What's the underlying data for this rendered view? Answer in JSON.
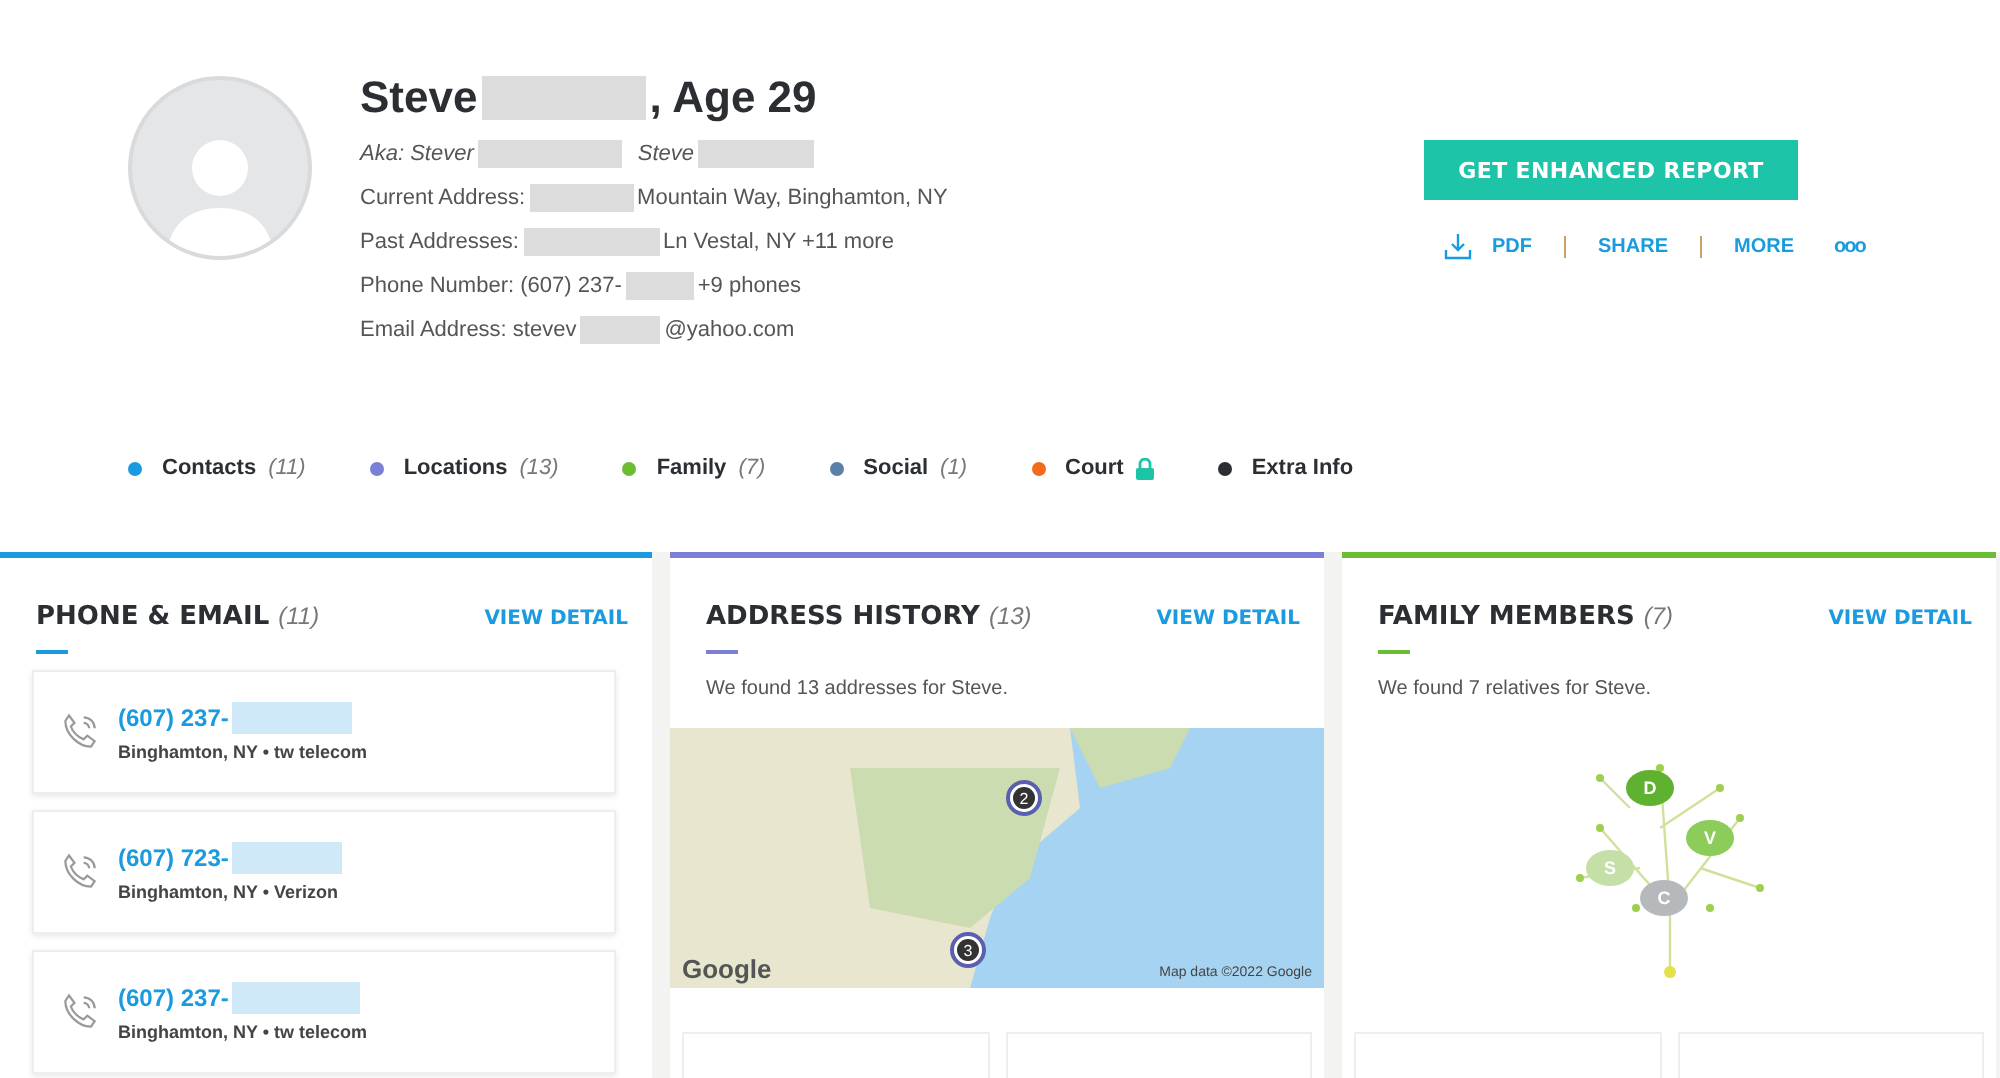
{
  "profile": {
    "name_first": "Steve",
    "name_rest": ", Age 29",
    "aka_label": "Aka:",
    "aka": [
      "Stever",
      "Steve"
    ],
    "details": [
      {
        "label": "Current Address:",
        "value": "Mountain Way, Binghamton, NY"
      },
      {
        "label": "Past Addresses:",
        "value": "Ln Vestal, NY +11 more"
      },
      {
        "label": "Phone Number: (607) 237-",
        "value": "+9 phones"
      },
      {
        "label": "Email Address: stevev",
        "value": "@yahoo.com"
      }
    ]
  },
  "actions": {
    "primary": "GET ENHANCED REPORT",
    "links": [
      "PDF",
      "SHARE",
      "MORE"
    ],
    "more_icon": "ooo"
  },
  "sections_nav": [
    {
      "label": "Contacts",
      "count": "(11)",
      "color": "#1a9be0",
      "locked": false
    },
    {
      "label": "Locations",
      "count": "(13)",
      "color": "#7b7fd6",
      "locked": false
    },
    {
      "label": "Family",
      "count": "(7)",
      "color": "#6cbd36",
      "locked": false
    },
    {
      "label": "Social",
      "count": "(1)",
      "color": "#5a7fa8",
      "locked": false
    },
    {
      "label": "Court",
      "color": "#f26b1d",
      "locked": true
    },
    {
      "label": "Extra Info",
      "color": "#2b2f33",
      "locked": false
    }
  ],
  "cards": [
    {
      "kind": "phones",
      "title": "PHONE & EMAIL",
      "count": "(11)",
      "color": "#1a9be0",
      "link": "VIEW DETAIL",
      "phones": [
        {
          "number": "(607) 237-",
          "sub": "Binghamton, NY • tw telecom"
        },
        {
          "number": "(607) 723-",
          "sub": "Binghamton, NY • Verizon"
        },
        {
          "number": "(607) 237-",
          "sub": "Binghamton, NY • tw telecom"
        }
      ]
    },
    {
      "kind": "map",
      "title": "ADDRESS HISTORY",
      "count": "(13)",
      "color": "#7b7fd6",
      "link": "VIEW DETAIL",
      "summary": "We found 13 addresses for Steve.",
      "markers": [
        "2",
        "3"
      ],
      "attribution": "Map data ©2022 Google",
      "brand": "Google"
    },
    {
      "kind": "tree",
      "title": "FAMILY MEMBERS",
      "count": "(7)",
      "color": "#6cbd36",
      "link": "VIEW DETAIL",
      "summary": "We found 7 relatives for Steve.",
      "leaves": [
        "D",
        "V",
        "S",
        "C"
      ]
    }
  ]
}
